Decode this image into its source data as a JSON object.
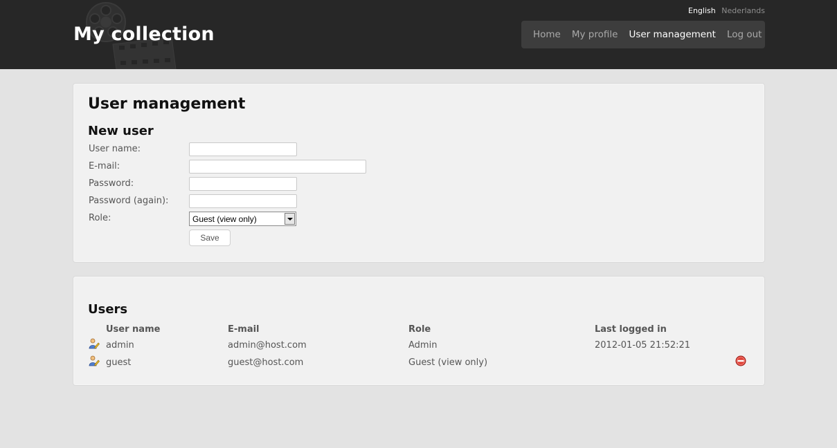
{
  "header": {
    "site_title": "My collection",
    "languages": [
      {
        "label": "English",
        "active": true
      },
      {
        "label": "Nederlands",
        "active": false
      }
    ],
    "nav": [
      {
        "label": "Home",
        "current": false
      },
      {
        "label": "My profile",
        "current": false
      },
      {
        "label": "User management",
        "current": true
      },
      {
        "label": "Log out",
        "current": false
      }
    ]
  },
  "new_user_panel": {
    "page_title": "User management",
    "section_title": "New user",
    "fields": {
      "username": {
        "label": "User name:",
        "value": ""
      },
      "email": {
        "label": "E-mail:",
        "value": ""
      },
      "password": {
        "label": "Password:",
        "value": ""
      },
      "password_again": {
        "label": "Password (again):",
        "value": ""
      },
      "role": {
        "label": "Role:",
        "selected": "Guest (view only)"
      }
    },
    "save_label": "Save"
  },
  "users_panel": {
    "section_title": "Users",
    "columns": {
      "username": "User name",
      "email": "E-mail",
      "role": "Role",
      "last_login": "Last logged in"
    },
    "rows": [
      {
        "username": "admin",
        "email": "admin@host.com",
        "role": "Admin",
        "last_login": "2012-01-05 21:52:21",
        "deletable": false
      },
      {
        "username": "guest",
        "email": "guest@host.com",
        "role": "Guest (view only)",
        "last_login": "",
        "deletable": true
      }
    ]
  },
  "icons": {
    "edit_user": "edit-user-icon",
    "delete": "delete-icon",
    "header_decoration": "film-reel-icon"
  },
  "colors": {
    "header_bg": "#272727",
    "nav_bg": "#3d3d3d",
    "page_bg": "#e3e3e3",
    "panel_bg": "#f1f1f1",
    "delete_red": "#d63b32"
  }
}
